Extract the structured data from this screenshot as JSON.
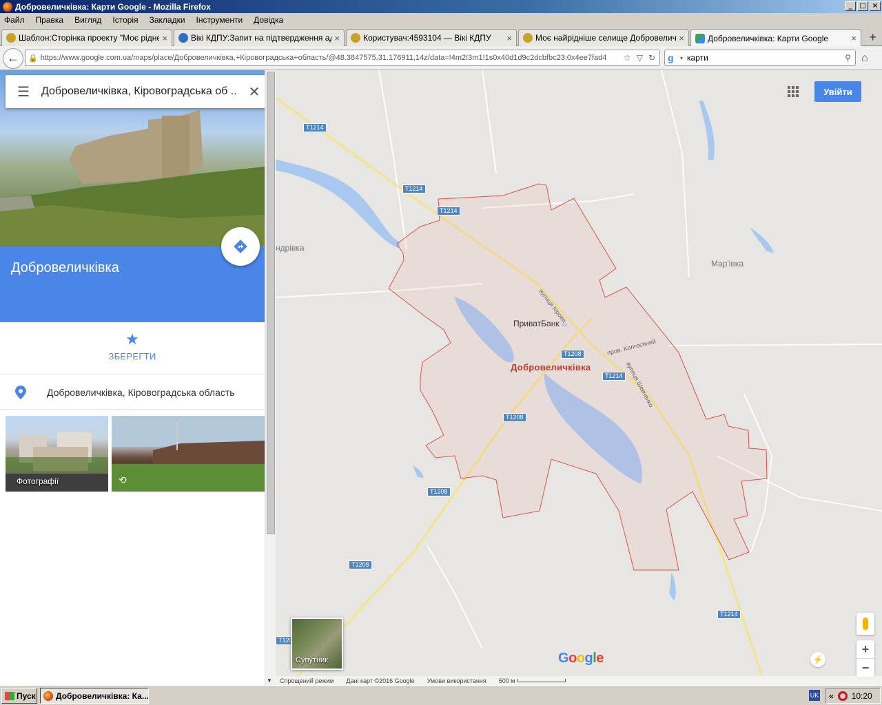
{
  "window": {
    "title": "Добровеличківка: Карти Google - Mozilla Firefox",
    "buttons": {
      "minimize": "_",
      "maximize": "□",
      "close": "×"
    }
  },
  "menu": [
    "Файл",
    "Правка",
    "Вигляд",
    "Історія",
    "Закладки",
    "Інструменти",
    "Довідка"
  ],
  "tabs": [
    {
      "label": "Шаблон:Сторінка проекту \"Моє рідне ...",
      "close": "×"
    },
    {
      "label": "Вікі КДПУ:Запит на підтвердження ад...",
      "close": "×"
    },
    {
      "label": "Користувач:4593104 — Вікі КДПУ",
      "close": "×"
    },
    {
      "label": "Моє найрідніше селище Добровеличків...",
      "close": "×"
    },
    {
      "label": "Добровеличківка: Карти Google",
      "close": "×"
    }
  ],
  "new_tab": "+",
  "nav": {
    "url": "https://www.google.com.ua/maps/place/Добровеличківка,+Кіровоградська+область/@48.3847575,31.176911,14z/data=!4m2!3m1!1s0x40d1d9c2dcbfbc23:0x4ee7fad4",
    "search_value": "карти"
  },
  "sidebar": {
    "search_query": "Добровеличківка, Кіровоградська об ...",
    "place_title": "Добровеличківка",
    "save_label": "ЗБЕРЕГТИ",
    "address": "Добровеличківка, Кіровоградська область",
    "photos_caption": "Фотографії"
  },
  "map": {
    "login_button": "Увійти",
    "city_label": "Добровеличківка",
    "poi_label": "ПриватБанк",
    "village_left": "ндрівка",
    "village_right": "Мар'івка",
    "streets": {
      "kirova": "вулиця Кірова",
      "kolhospnyi": "пров. Колгоспний",
      "shevchenko": "вулиця Шевченко"
    },
    "road_badges": [
      "T1214",
      "T1214",
      "T1214",
      "T1208",
      "T1214",
      "T1208",
      "T1208",
      "T1208",
      "T1214",
      "T1208"
    ],
    "satellite_label": "Супутник",
    "logo": "Google",
    "zoom_in": "+",
    "zoom_out": "−",
    "footer": {
      "mode": "Спрощений режим",
      "data": "Дані карт ©2016 Google",
      "terms": "Умови використання",
      "scale": "500 м"
    },
    "colors": {
      "boundary": "#d9534f",
      "water": "#a8c8f0",
      "road": "#f4e48a",
      "accent": "#4a86e8"
    }
  },
  "taskbar": {
    "start": "Пуск",
    "task": "Добровеличківка: Ка...",
    "lang": "UK",
    "chevron": "«",
    "time": "10:20"
  }
}
